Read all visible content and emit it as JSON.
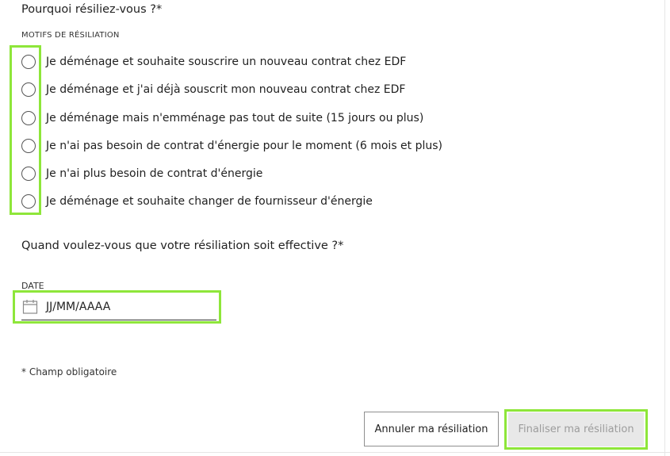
{
  "questions": {
    "reason": "Pourquoi résiliez-vous ?*",
    "effective_date": "Quand voulez-vous que votre résiliation soit effective ?*"
  },
  "reasons_section": {
    "label": "MOTIFS DE RÉSILIATION",
    "options": [
      "Je déménage et souhaite souscrire un nouveau contrat chez EDF",
      "Je déménage et j'ai déjà souscrit mon nouveau contrat chez EDF",
      "Je déménage mais n'emménage pas tout de suite (15 jours ou plus)",
      "Je n'ai pas besoin de contrat d'énergie pour le moment (6 mois et plus)",
      "Je n'ai plus besoin de contrat d'énergie",
      "Je déménage et souhaite changer de fournisseur d'énergie"
    ]
  },
  "date_field": {
    "label": "DATE",
    "placeholder": "JJ/MM/AAAA",
    "icon": "calendar-icon"
  },
  "required_note": "* Champ obligatoire",
  "buttons": {
    "cancel": "Annuler ma résiliation",
    "finalize": "Finaliser ma résiliation"
  },
  "colors": {
    "highlight": "#8ee63a",
    "disabled_button_bg": "#e8e8e8",
    "disabled_button_text": "#9c9c9c"
  }
}
